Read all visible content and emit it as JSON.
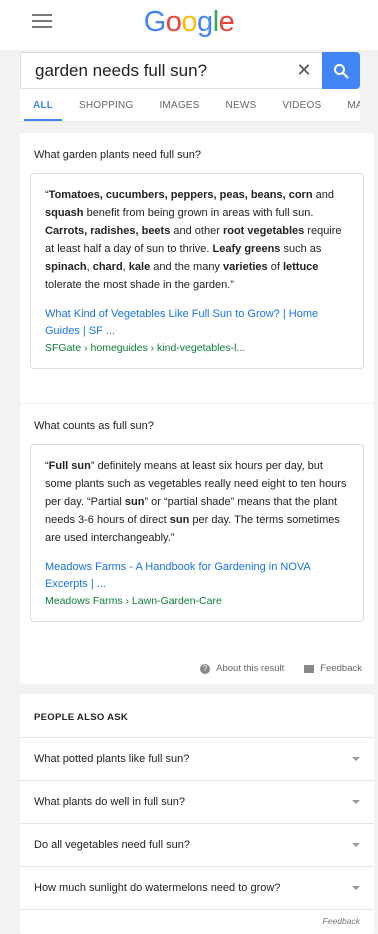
{
  "logo": {
    "letters": [
      "G",
      "o",
      "o",
      "g",
      "l",
      "e"
    ],
    "colors": [
      "#4285f4",
      "#ea4335",
      "#fbbc05",
      "#4285f4",
      "#34a853",
      "#ea4335"
    ]
  },
  "search": {
    "value": "garden needs full sun?",
    "clear_glyph": "✕"
  },
  "tabs": [
    "ALL",
    "SHOPPING",
    "IMAGES",
    "NEWS",
    "VIDEOS",
    "MA"
  ],
  "featured": [
    {
      "question": "What garden plants need full sun?",
      "quote_parts": [
        {
          "t": "“",
          "b": false
        },
        {
          "t": "Tomatoes, cucumbers, peppers, peas, beans, corn",
          "b": true
        },
        {
          "t": " and ",
          "b": false
        },
        {
          "t": "squash",
          "b": true
        },
        {
          "t": " benefit from being grown in areas with full sun. ",
          "b": false
        },
        {
          "t": "Carrots, radishes, beets",
          "b": true
        },
        {
          "t": " and other ",
          "b": false
        },
        {
          "t": "root vegetables",
          "b": true
        },
        {
          "t": " require at least half a day of sun to thrive. ",
          "b": false
        },
        {
          "t": "Leafy greens",
          "b": true
        },
        {
          "t": " such as ",
          "b": false
        },
        {
          "t": "spinach",
          "b": true
        },
        {
          "t": ", ",
          "b": false
        },
        {
          "t": "chard",
          "b": true
        },
        {
          "t": ", ",
          "b": false
        },
        {
          "t": "kale",
          "b": true
        },
        {
          "t": " and the many ",
          "b": false
        },
        {
          "t": "varieties",
          "b": true
        },
        {
          "t": " of ",
          "b": false
        },
        {
          "t": "lettuce",
          "b": true
        },
        {
          "t": " tolerate the most shade in the garden.”",
          "b": false
        }
      ],
      "link": "What Kind of Vegetables Like Full Sun to Grow? | Home Guides | SF ...",
      "url": "SFGate › homeguides › kind-vegetables-l..."
    },
    {
      "question": "What counts as full sun?",
      "quote_parts": [
        {
          "t": "“",
          "b": false
        },
        {
          "t": "Full sun",
          "b": true
        },
        {
          "t": "” definitely means at least six hours per day, but some plants such as vegetables really need eight to ten hours per day. “Partial ",
          "b": false
        },
        {
          "t": "sun",
          "b": true
        },
        {
          "t": "” or “partial shade” means that the plant needs 3-6 hours of direct ",
          "b": false
        },
        {
          "t": "sun",
          "b": true
        },
        {
          "t": " per day. The terms sometimes are used interchangeably.”",
          "b": false
        }
      ],
      "link": "Meadows Farms - A Handbook for Gardening in NOVA Excerpts | ...",
      "url": "Meadows Farms › Lawn-Garden-Care"
    }
  ],
  "about": {
    "about_label": "About this result",
    "feedback_label": "Feedback"
  },
  "people_also_ask": {
    "title": "PEOPLE ALSO ASK",
    "questions": [
      "What potted plants like full sun?",
      "What plants do well in full sun?",
      "Do all vegetables need full sun?",
      "How much sunlight do watermelons need to grow?"
    ],
    "feedback_label": "Feedback"
  }
}
